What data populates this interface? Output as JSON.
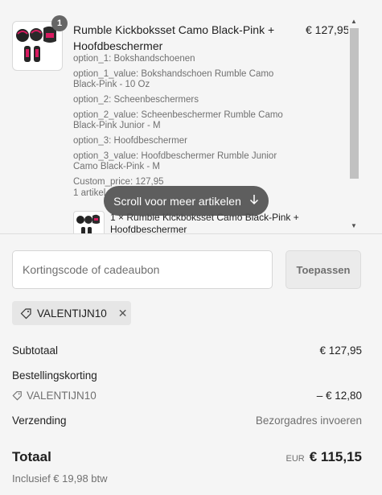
{
  "item": {
    "quantity": "1",
    "title": "Rumble Kickboksset Camo Black-Pink + Hoofdbeschermer",
    "price": "€ 127,95",
    "options": [
      "option_1: Bokshandschoenen",
      "option_1_value: Bokshandschoen Rumble Camo Black-Pink - 10 Oz",
      "option_2: Scheenbeschermers",
      "option_2_value: Scheenbeschermer Rumble Camo Black-Pink Junior - M",
      "option_3: Hoofdbeschermer",
      "option_3_value: Hoofdbeschermer Rumble Junior Camo Black-Pink - M",
      "Custom_price: 127,95",
      "1 artikel"
    ],
    "sub_item": "1 × Rumble Kickboksset Camo Black-Pink + Hoofdbeschermer"
  },
  "scroll_hint": "Scroll voor meer artikelen",
  "discount": {
    "placeholder": "Kortingscode of cadeaubon",
    "apply_label": "Toepassen",
    "applied_code": "VALENTIJN10"
  },
  "summary": {
    "subtotal_label": "Subtotaal",
    "subtotal_value": "€ 127,95",
    "order_discount_label": "Bestellingskorting",
    "discount_code": "VALENTIJN10",
    "discount_value": "– € 12,80",
    "shipping_label": "Verzending",
    "shipping_value": "Bezorgadres invoeren",
    "total_label": "Totaal",
    "currency": "EUR",
    "total_value": "€ 115,15",
    "tax_note": "Inclusief € 19,98 btw"
  },
  "colors": {
    "accent_pink": "#d81b60",
    "text": "#1f1f1f",
    "muted": "#707070"
  }
}
